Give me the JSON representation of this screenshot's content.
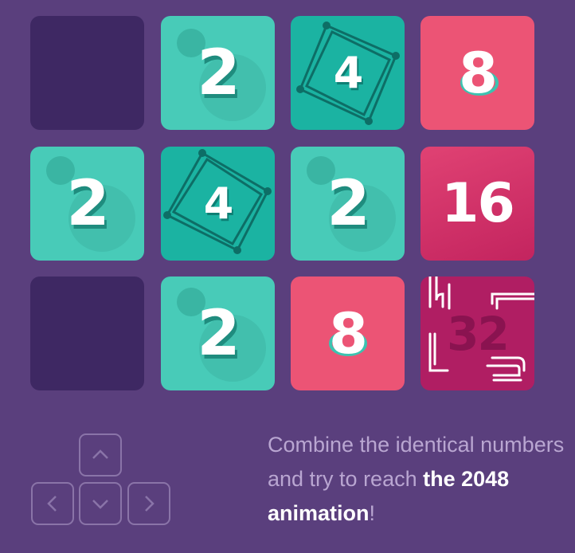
{
  "board": {
    "tiles": [
      {
        "value": "",
        "kind": "empty"
      },
      {
        "value": "2",
        "kind": "t2"
      },
      {
        "value": "4",
        "kind": "t4"
      },
      {
        "value": "8",
        "kind": "t8"
      },
      {
        "value": "2",
        "kind": "t2"
      },
      {
        "value": "4",
        "kind": "t4"
      },
      {
        "value": "2",
        "kind": "t2"
      },
      {
        "value": "16",
        "kind": "t16"
      },
      {
        "value": "",
        "kind": "empty"
      },
      {
        "value": "2",
        "kind": "t2"
      },
      {
        "value": "8",
        "kind": "t8"
      },
      {
        "value": "32",
        "kind": "t32"
      }
    ]
  },
  "controls": {
    "up_icon": "chevron-up-icon",
    "left_icon": "chevron-left-icon",
    "down_icon": "chevron-down-icon",
    "right_icon": "chevron-right-icon"
  },
  "caption": {
    "line_text": "Combine the identical numbers and try to reach ",
    "strong_text": "the 2048 animation",
    "end_text": "!"
  },
  "colors": {
    "background": "#5a3f7d",
    "empty": "#3e2863",
    "tile_2": "#48cbb8",
    "tile_4": "#1bb3a2",
    "tile_8": "#ec5475",
    "tile_16": "#d63468",
    "tile_32": "#b01e63"
  }
}
